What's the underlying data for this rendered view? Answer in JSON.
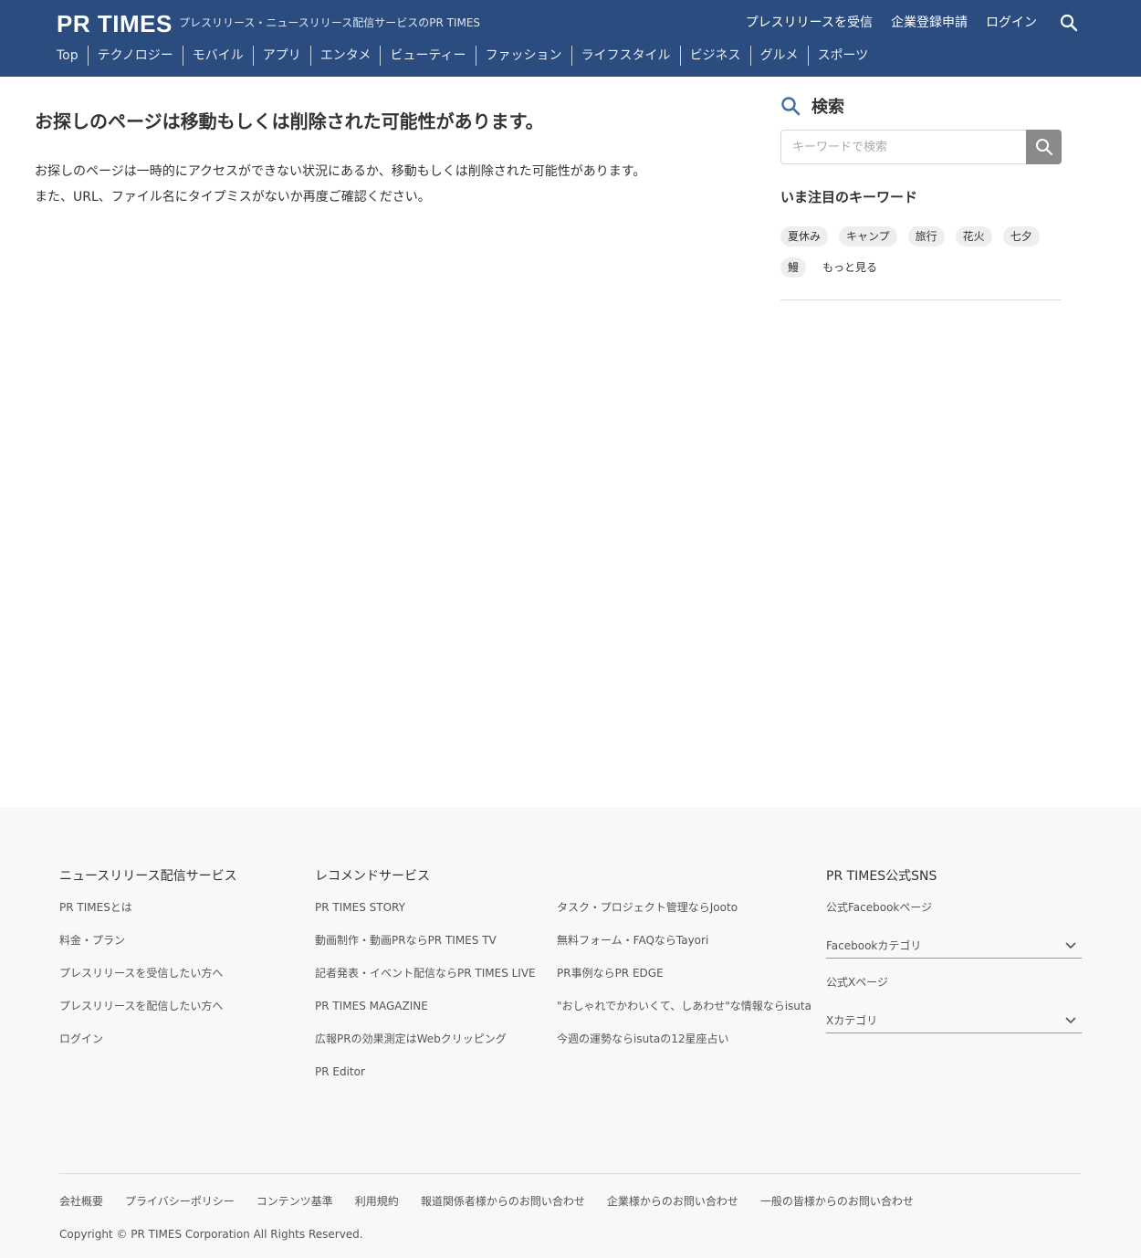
{
  "header": {
    "logo": "PR TIMES",
    "tagline": "プレスリリース・ニュースリリース配信サービスのPR TIMES",
    "links": [
      "プレスリリースを受信",
      "企業登録申請",
      "ログイン"
    ],
    "search_icon": "search-icon",
    "categories": [
      "Top",
      "テクノロジー",
      "モバイル",
      "アプリ",
      "エンタメ",
      "ビューティー",
      "ファッション",
      "ライフスタイル",
      "ビジネス",
      "グルメ",
      "スポーツ"
    ]
  },
  "main": {
    "title": "お探しのページは移動もしくは削除された可能性があります。",
    "body_line1": "お探しのページは一時的にアクセスができない状況にあるか、移動もしくは削除された可能性があります。",
    "body_line2": "また、URL、ファイル名にタイプミスがないか再度ご確認ください。"
  },
  "sidebar": {
    "search_heading": "検索",
    "search_placeholder": "キーワードで検索",
    "keywords_heading": "いま注目のキーワード",
    "keywords": [
      "夏休み",
      "キャンプ",
      "旅行",
      "花火",
      "七夕",
      "鰻"
    ],
    "more_label": "もっと見る"
  },
  "footer": {
    "col1": {
      "title": "ニュースリリース配信サービス",
      "links": [
        "PR TIMESとは",
        "料金・プラン",
        "プレスリリースを受信したい方へ",
        "プレスリリースを配信したい方へ",
        "ログイン"
      ]
    },
    "col2": {
      "title": "レコメンドサービス",
      "links": [
        "PR TIMES STORY",
        "動画制作・動画PRならPR TIMES TV",
        "記者発表・イベント配信ならPR TIMES LIVE",
        "PR TIMES MAGAZINE",
        "広報PRの効果測定はWebクリッピング",
        "PR Editor"
      ]
    },
    "col3": {
      "links": [
        "タスク・プロジェクト管理ならJooto",
        "無料フォーム・FAQならTayori",
        "PR事例ならPR EDGE",
        "\"おしゃれでかわいくて、しあわせ\"な情報ならisuta",
        "今週の運勢ならisutaの12星座占い"
      ]
    },
    "col4": {
      "title": "PR TIMES公式SNS",
      "facebook_page": "公式Facebookページ",
      "facebook_select": "Facebookカテゴリ",
      "x_page": "公式Xページ",
      "x_select": "Xカテゴリ"
    },
    "bottom_links": [
      "会社概要",
      "プライバシーポリシー",
      "コンテンツ基準",
      "利用規約",
      "報道関係者様からのお問い合わせ",
      "企業様からのお問い合わせ",
      "一般の皆様からのお問い合わせ"
    ],
    "copyright": "Copyright © PR TIMES Corporation All Rights Reserved."
  },
  "colors": {
    "header_bg": "#2b4c7e",
    "search_icon_accent": "#3a6fa5",
    "search_button_bg": "#8a8a8a",
    "footer_bg": "#f8f8f8"
  }
}
